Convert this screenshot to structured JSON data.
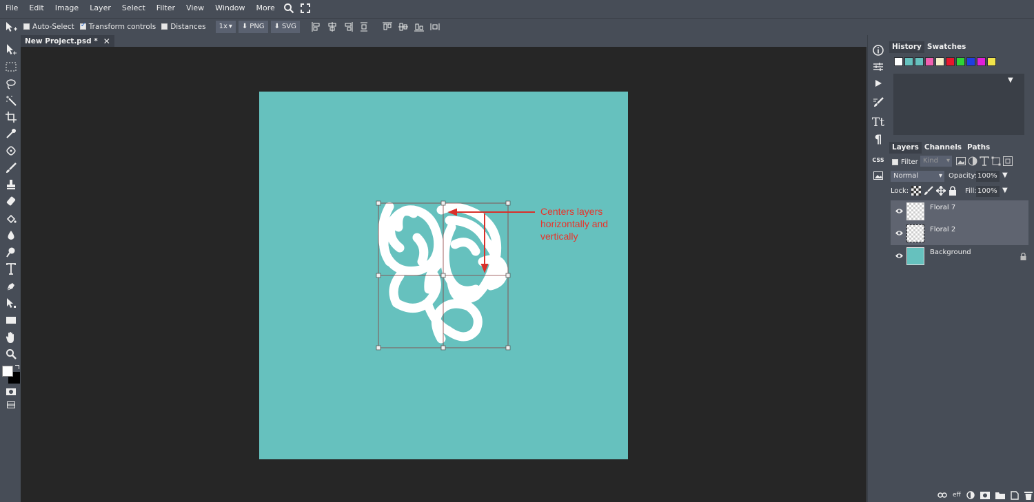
{
  "menu": {
    "items": [
      "File",
      "Edit",
      "Image",
      "Layer",
      "Select",
      "Filter",
      "View",
      "Window",
      "More"
    ]
  },
  "options": {
    "auto_select": "Auto-Select",
    "transform_controls": "Transform controls",
    "distances": "Distances",
    "zoom": "1x",
    "png": "PNG",
    "svg": "SVG"
  },
  "document_tab": {
    "title": "New Project.psd *",
    "close": "✕"
  },
  "annotation": {
    "text": "Centers layers horizontally and vertically"
  },
  "history_panel": {
    "tabs": [
      "History",
      "Swatches"
    ],
    "swatch_colors": [
      "#ffffff",
      "#66c1be",
      "#66c1be",
      "#f05fb0",
      "#f5f0c8",
      "#e8152c",
      "#2fd436",
      "#1e3fe0",
      "#e01fd8",
      "#f2e44a"
    ]
  },
  "layers_panel": {
    "tabs": [
      "Layers",
      "Channels",
      "Paths"
    ],
    "filter_label": "Filter",
    "kind_label": "Kind",
    "blend_mode": "Normal",
    "opacity_label": "Opacity:",
    "opacity_value": "100%",
    "lock_label": "Lock:",
    "fill_label": "Fill:",
    "fill_value": "100%",
    "layers": [
      {
        "name": "Floral 7",
        "selected": true
      },
      {
        "name": "Floral 2",
        "selected": true
      },
      {
        "name": "Background",
        "selected": false,
        "locked": true
      }
    ],
    "footer_fx": "eff"
  },
  "right_strip": {
    "css_label": "CSS"
  },
  "colors": {
    "accent": "#66c1be",
    "annotation": "#e8332a",
    "ui_bg": "#474d57",
    "workspace": "#262626"
  }
}
